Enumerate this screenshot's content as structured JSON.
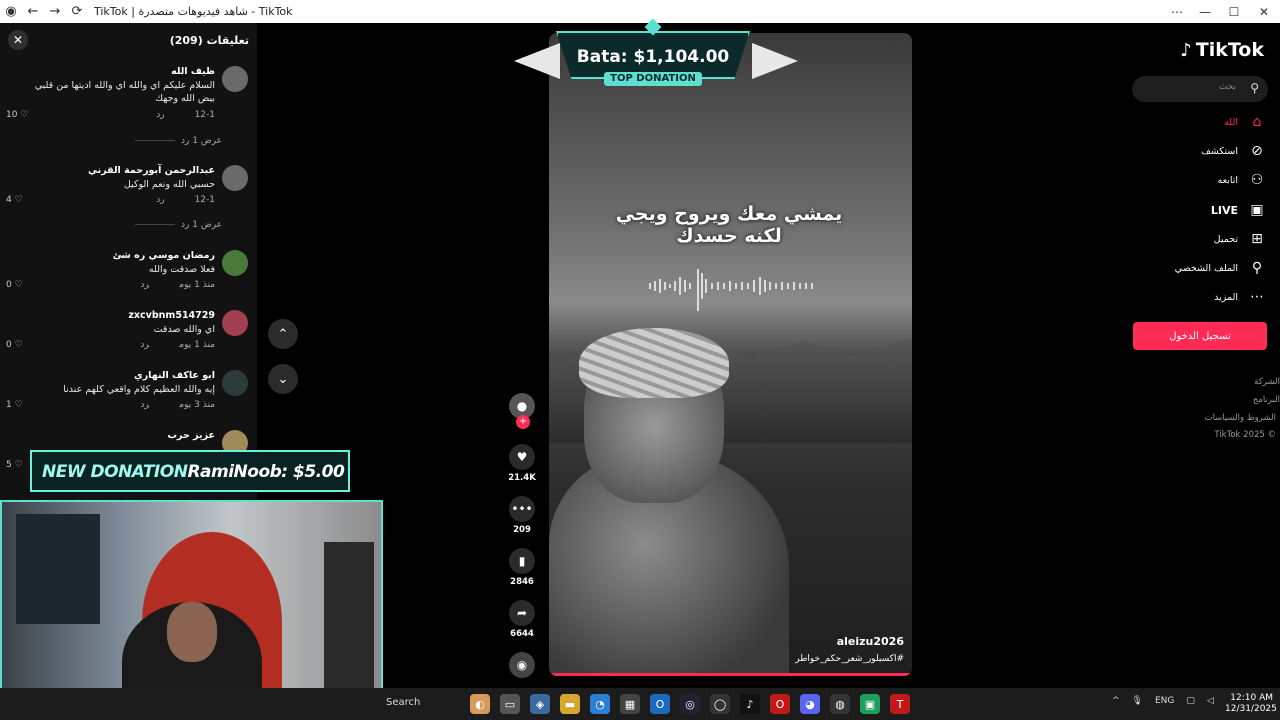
{
  "browser": {
    "tab_title": "TikTok | شاهد فيديوهات متصدرة - TikTok",
    "min_label": "—",
    "max_label": "☐",
    "close_label": "✕",
    "more_label": "⋯"
  },
  "comments": {
    "header": "تعليقات (209)",
    "close_label": "✕",
    "reply_label": "رد",
    "items": [
      {
        "name": "ظيف الله",
        "text": "السلام عليكم اي والله اي والله اديتها من قلبي بيض الله وجهك",
        "date": "12-1",
        "likes": "10"
      },
      {
        "name": "عبدالرحمن آبورحمة القرني",
        "text": "حسبي الله ونعم الوكيل",
        "date": "12-1",
        "likes": "4"
      },
      {
        "name": "رمضان موسي ره شئ",
        "text": "فعلا صدقت والله",
        "date": "منذ 1 يوم",
        "likes": "0"
      },
      {
        "name": "zxcvbnm514729",
        "text": "اي والله صدقت",
        "date": "منذ 1 يوم",
        "likes": "0"
      },
      {
        "name": "ابو عاكف النهاري",
        "text": "إيه والله العظيم كلام واقعي كلهم عندنا",
        "date": "منذ 3 يوم",
        "likes": "1"
      },
      {
        "name": "عزيز حرب",
        "text": "",
        "date": "",
        "likes": "5"
      }
    ],
    "view_more": "عرض 1 رد"
  },
  "overlay": {
    "top_amount": "Bata: $1,104.00",
    "top_label": "TOP DONATION",
    "new_label": "NEW DONATION",
    "new_text": "RamiNoob: $5.00"
  },
  "video": {
    "caption_line1": "يمشي معك ويروح ويجي",
    "caption_line2": "لكنه حسدك",
    "username": "aleizu2026",
    "hashtags": "#اكسبلور_شعر_حكم_خواطر",
    "progress": 1.0
  },
  "actions": {
    "likes": "21.4K",
    "comments": "209",
    "saves": "2846",
    "shares": "6644"
  },
  "sidebar": {
    "logo": "TikTok",
    "search_placeholder": "بحث",
    "nav": [
      {
        "label": "الله",
        "icon": "home-icon"
      },
      {
        "label": "استكشف",
        "icon": "compass-icon"
      },
      {
        "label": "اتابعه",
        "icon": "follow-icon"
      },
      {
        "label": "LIVE",
        "icon": "live-icon"
      },
      {
        "label": "تحميل",
        "icon": "upload-icon"
      },
      {
        "label": "الملف الشخصي",
        "icon": "profile-icon"
      },
      {
        "label": "المزيد",
        "icon": "more-icon"
      }
    ],
    "login": "تسجيل الدخول",
    "footer": [
      "الشركة",
      "البرنامج",
      "الشروط والسياسات",
      "© 2025 TikTok"
    ]
  },
  "taskbar": {
    "search": "Search",
    "lang": "ENG",
    "time": "12:10 AM",
    "date": "12/31/2025"
  },
  "colors": {
    "accent": "#fe2c55",
    "donation": "#5de0d0"
  }
}
